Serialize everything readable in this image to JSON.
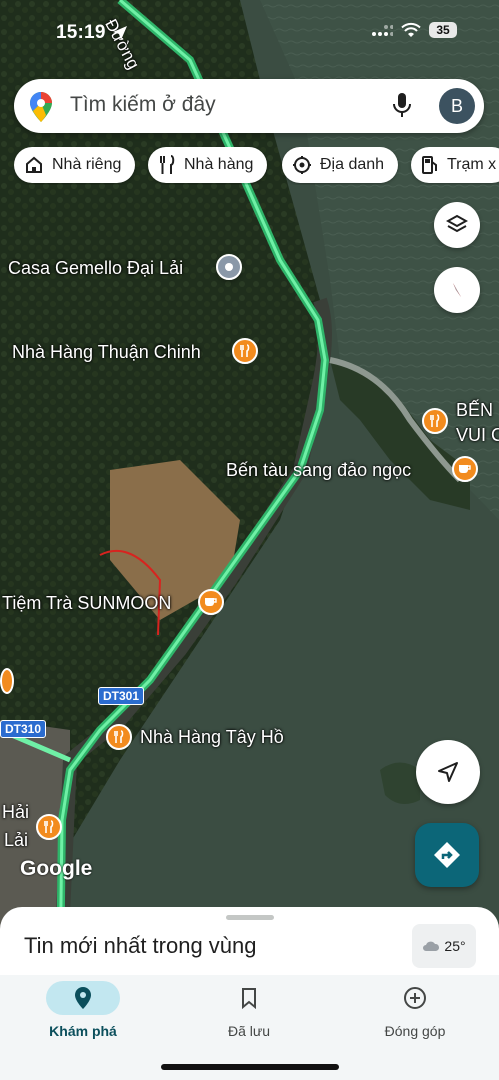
{
  "status_bar": {
    "time": "15:19",
    "battery": "35"
  },
  "search": {
    "placeholder": "Tìm kiếm ở đây",
    "avatar_letter": "B"
  },
  "chips": [
    {
      "label": "Nhà riêng",
      "icon": "home-icon"
    },
    {
      "label": "Nhà hàng",
      "icon": "restaurant-icon"
    },
    {
      "label": "Địa danh",
      "icon": "landmark-icon"
    },
    {
      "label": "Trạm x",
      "icon": "gas-station-icon"
    }
  ],
  "map": {
    "street_label": "Đường",
    "places": [
      {
        "name": "Casa Gemello Đại Lải",
        "icon": "place-icon"
      },
      {
        "name": "Nhà Hàng Thuận Chinh",
        "icon": "restaurant-icon"
      },
      {
        "name": "BẾN",
        "icon": "restaurant-icon"
      },
      {
        "name": "VUI C",
        "icon": "restaurant-icon"
      },
      {
        "name": "Bến tàu sang đảo ngọc",
        "icon": "cafe-icon"
      },
      {
        "name": "Tiệm Trà SUNMOON",
        "icon": "cafe-icon"
      },
      {
        "name": "Nhà Hàng Tây Hồ",
        "icon": "restaurant-icon"
      },
      {
        "name": "Hải",
        "icon": "restaurant-icon"
      },
      {
        "name": "Lải",
        "icon": ""
      }
    ],
    "road_shields": [
      "DT301",
      "DT310"
    ],
    "logo": "Google"
  },
  "sheet": {
    "title": "Tin mới nhất trong vùng",
    "weather": "25°"
  },
  "bottom_nav": [
    {
      "label": "Khám phá",
      "icon": "explore-pin-icon",
      "active": true
    },
    {
      "label": "Đã lưu",
      "icon": "bookmark-icon",
      "active": false
    },
    {
      "label": "Đóng góp",
      "icon": "add-circle-icon",
      "active": false
    }
  ],
  "colors": {
    "accent": "#0c6678",
    "poi": "#f28b1e",
    "route": "#3ddc84",
    "active_tab": "#c2e7f0"
  }
}
